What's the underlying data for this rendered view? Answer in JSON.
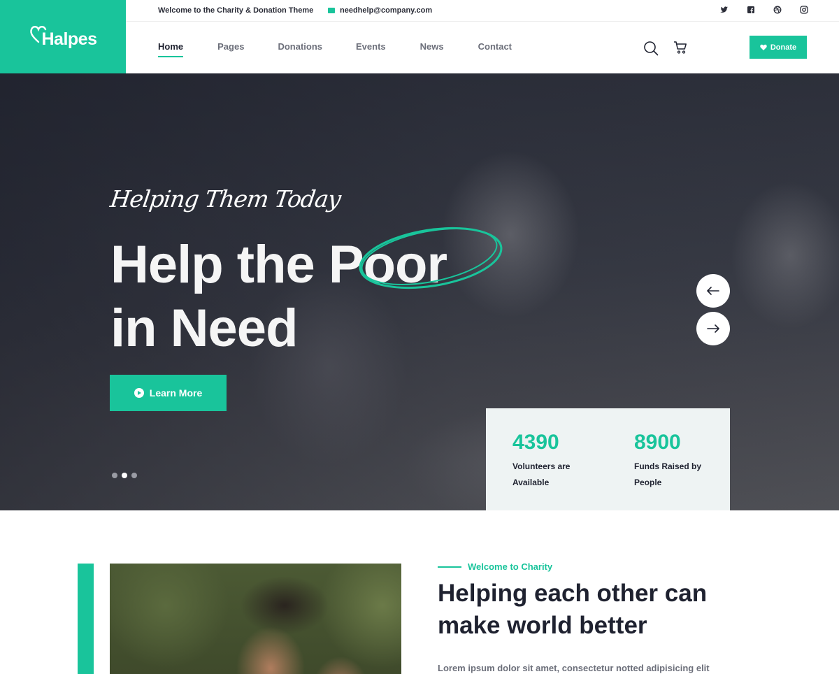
{
  "brand": {
    "name": "Halpes"
  },
  "topbar": {
    "welcome": "Welcome to the Charity & Donation Theme",
    "email": "needhelp@company.com",
    "socials": [
      "twitter-icon",
      "facebook-icon",
      "dribbble-icon",
      "instagram-icon"
    ]
  },
  "nav": {
    "items": [
      {
        "label": "Home",
        "active": true
      },
      {
        "label": "Pages"
      },
      {
        "label": "Donations"
      },
      {
        "label": "Events"
      },
      {
        "label": "News"
      },
      {
        "label": "Contact"
      }
    ],
    "donate_label": "Donate"
  },
  "hero": {
    "script": "Helping Them Today",
    "title_line1_a": "Help the ",
    "title_line1_b": "Poor",
    "title_line2": "in Need",
    "cta": "Learn More",
    "slides": 3,
    "active_slide": 2
  },
  "stats": [
    {
      "value": "4390",
      "label": "Volunteers are Available"
    },
    {
      "value": "8900",
      "label": "Funds Raised by People"
    }
  ],
  "about": {
    "kicker": "Welcome to Charity",
    "title": "Helping each other can make world better",
    "text": "Lorem ipsum dolor sit amet, consectetur notted adipisicing elit"
  },
  "colors": {
    "accent": "#19c49b",
    "dark": "#1f2230",
    "stats_bg": "#eef3f3"
  }
}
